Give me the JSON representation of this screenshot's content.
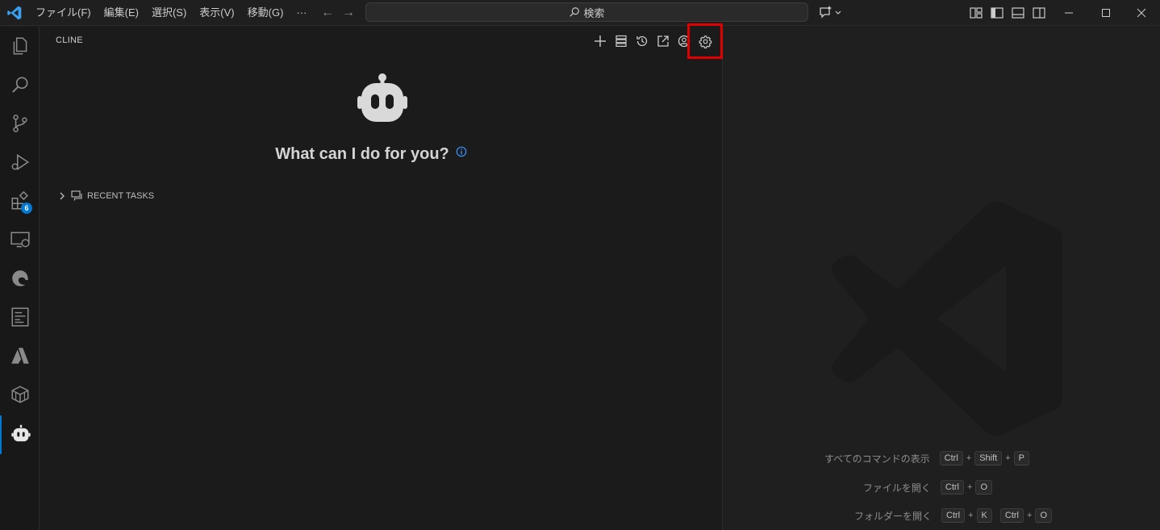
{
  "titlebar": {
    "menu": [
      "ファイル(F)",
      "編集(E)",
      "選択(S)",
      "表示(V)",
      "移動(G)",
      "···"
    ],
    "search_placeholder": "検索"
  },
  "activitybar": {
    "items": [
      "explorer-icon",
      "search-icon",
      "source-control-icon",
      "run-debug-icon",
      "extensions-icon",
      "remote-explorer-icon",
      "edge-icon",
      "notebook-icon",
      "azure-icon",
      "package-icon",
      "cline-icon"
    ],
    "extensions_badge": "6"
  },
  "sidebar": {
    "title": "CLINE",
    "actions": [
      "plus-icon",
      "mcp-server-icon",
      "history-icon",
      "popout-icon",
      "account-icon",
      "gear-icon"
    ],
    "welcome": "What can I do for you?",
    "recent_tasks": "RECENT TASKS"
  },
  "editor": {
    "shortcuts": [
      {
        "label": "すべてのコマンドの表示",
        "keys": [
          [
            "Ctrl",
            "Shift",
            "P"
          ]
        ]
      },
      {
        "label": "ファイルを開く",
        "keys": [
          [
            "Ctrl",
            "O"
          ]
        ]
      },
      {
        "label": "フォルダーを開く",
        "keys": [
          [
            "Ctrl",
            "K"
          ],
          [
            "Ctrl",
            "O"
          ]
        ]
      }
    ]
  },
  "colors": {
    "accent": "#0078d4",
    "highlight": "#e00000"
  }
}
